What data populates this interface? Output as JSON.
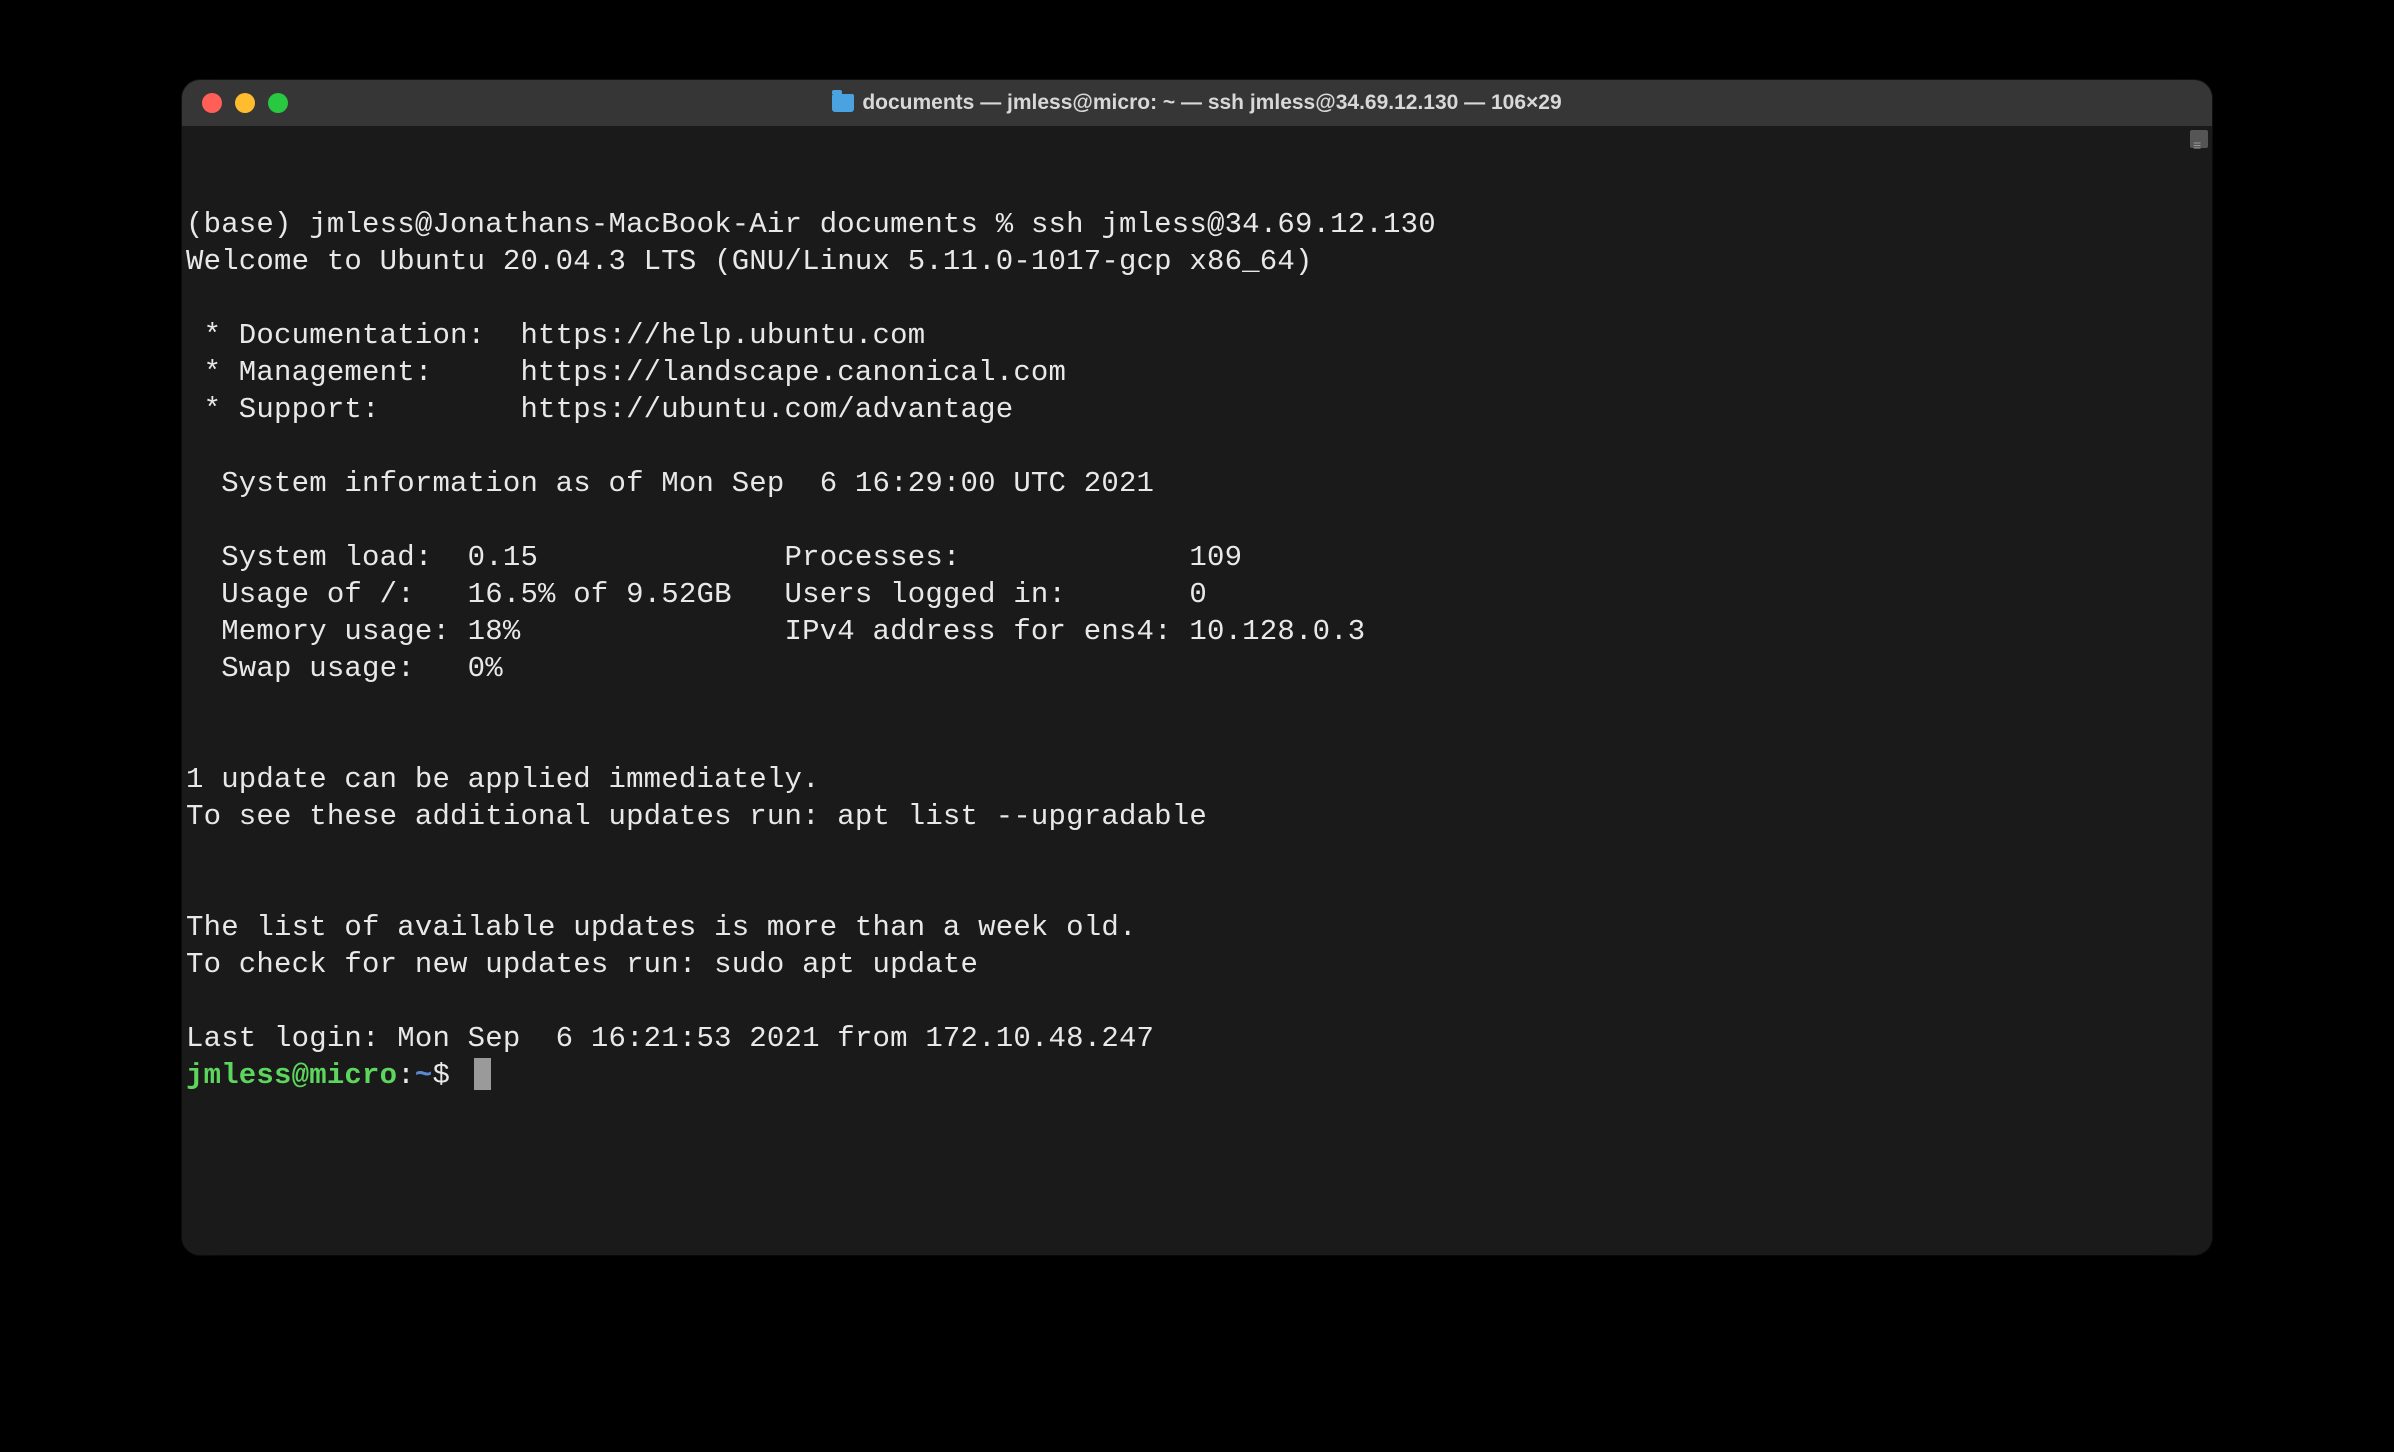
{
  "window": {
    "title": "documents — jmless@micro: ~ — ssh jmless@34.69.12.130 — 106×29"
  },
  "local_prompt": "(base) jmless@Jonathans-MacBook-Air documents % ",
  "command": "ssh jmless@34.69.12.130",
  "motd": {
    "welcome": "Welcome to Ubuntu 20.04.3 LTS (GNU/Linux 5.11.0-1017-gcp x86_64)",
    "links": {
      "doc": " * Documentation:  https://help.ubuntu.com",
      "mgmt": " * Management:     https://landscape.canonical.com",
      "support": " * Support:        https://ubuntu.com/advantage"
    },
    "sysinfo_header": "  System information as of Mon Sep  6 16:29:00 UTC 2021",
    "stats": {
      "l1": "  System load:  0.15              Processes:             109",
      "l2": "  Usage of /:   16.5% of 9.52GB   Users logged in:       0",
      "l3": "  Memory usage: 18%               IPv4 address for ens4: 10.128.0.3",
      "l4": "  Swap usage:   0%"
    },
    "updates1": "1 update can be applied immediately.",
    "updates2": "To see these additional updates run: apt list --upgradable",
    "stale1": "The list of available updates is more than a week old.",
    "stale2": "To check for new updates run: sudo apt update",
    "lastlogin": "Last login: Mon Sep  6 16:21:53 2021 from 172.10.48.247"
  },
  "remote_prompt": {
    "userhost": "jmless@micro",
    "colon": ":",
    "path": "~",
    "dollar": "$ "
  }
}
